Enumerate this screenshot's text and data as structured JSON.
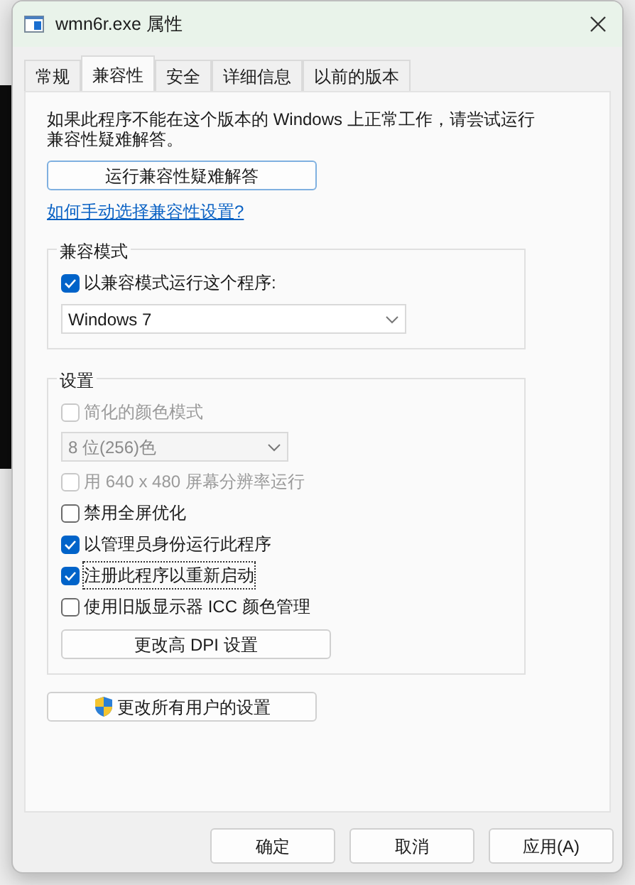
{
  "window": {
    "title": "wmn6r.exe 属性"
  },
  "tabs": [
    {
      "label": "常规",
      "selected": false
    },
    {
      "label": "兼容性",
      "selected": true
    },
    {
      "label": "安全",
      "selected": false
    },
    {
      "label": "详细信息",
      "selected": false
    },
    {
      "label": "以前的版本",
      "selected": false
    }
  ],
  "intro": "如果此程序不能在这个版本的 Windows 上正常工作，请尝试运行兼容性疑难解答。",
  "troubleshoot_button": "运行兼容性疑难解答",
  "help_link": "如何手动选择兼容性设置?",
  "compat_group": {
    "legend": "兼容模式",
    "checkbox": {
      "label": "以兼容模式运行这个程序:",
      "checked": true
    },
    "select": {
      "value": "Windows 7"
    }
  },
  "settings_group": {
    "legend": "设置",
    "items": [
      {
        "kind": "checkbox",
        "label": "简化的颜色模式",
        "checked": false,
        "disabled": true,
        "focused": false
      },
      {
        "kind": "select",
        "value": "8 位(256)色",
        "disabled": true
      },
      {
        "kind": "checkbox",
        "label": "用 640 x 480 屏幕分辨率运行",
        "checked": false,
        "disabled": true,
        "focused": false
      },
      {
        "kind": "checkbox",
        "label": "禁用全屏优化",
        "checked": false,
        "disabled": false,
        "focused": false
      },
      {
        "kind": "checkbox",
        "label": "以管理员身份运行此程序",
        "checked": true,
        "disabled": false,
        "focused": false
      },
      {
        "kind": "checkbox",
        "label": "注册此程序以重新启动",
        "checked": true,
        "disabled": false,
        "focused": true
      },
      {
        "kind": "checkbox",
        "label": "使用旧版显示器 ICC 颜色管理",
        "checked": false,
        "disabled": false,
        "focused": false
      }
    ],
    "dpi_button": "更改高 DPI 设置"
  },
  "all_users_button": "更改所有用户的设置",
  "footer_buttons": [
    "确定",
    "取消",
    "应用(A)"
  ]
}
